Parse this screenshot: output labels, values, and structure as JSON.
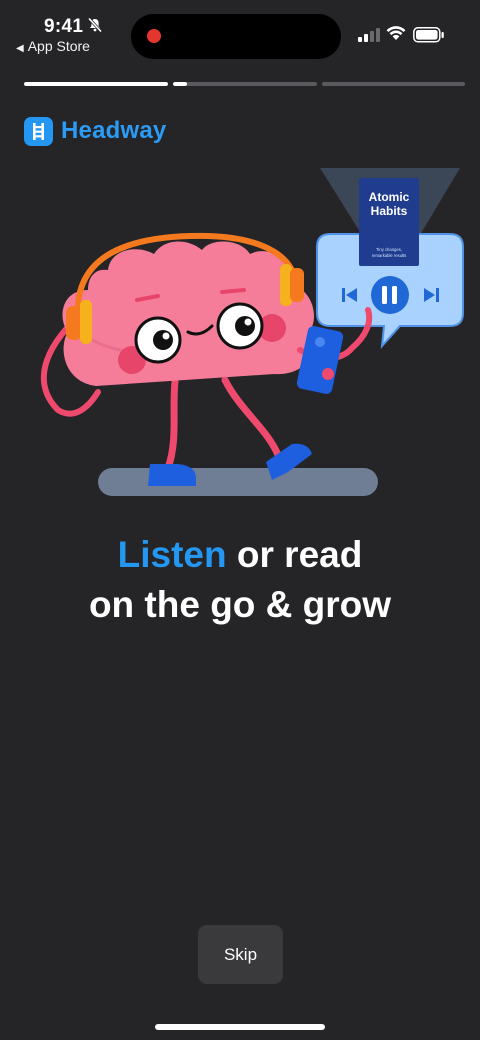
{
  "status_bar": {
    "time": "9:41",
    "back_app_label": "App Store"
  },
  "progress": {
    "segments": [
      {
        "fraction": 1.0
      },
      {
        "fraction": 0.1
      },
      {
        "fraction": 0.0
      }
    ]
  },
  "brand": {
    "name": "Headway",
    "accent_color": "#2497f3"
  },
  "illustration": {
    "book_title_line1": "Atomic",
    "book_title_line2": "Habits",
    "book_subtitle_line1": "Tiny changes,",
    "book_subtitle_line2": "remarkable results"
  },
  "headline": {
    "accent": "Listen",
    "rest_line1": " or read",
    "line2": "on the go & grow"
  },
  "actions": {
    "skip_label": "Skip"
  },
  "icons": [
    "mute-icon",
    "signal-icon",
    "wifi-icon",
    "battery-icon",
    "back-triangle-icon",
    "headway-logo-icon",
    "previous-track-icon",
    "pause-icon",
    "next-track-icon"
  ]
}
